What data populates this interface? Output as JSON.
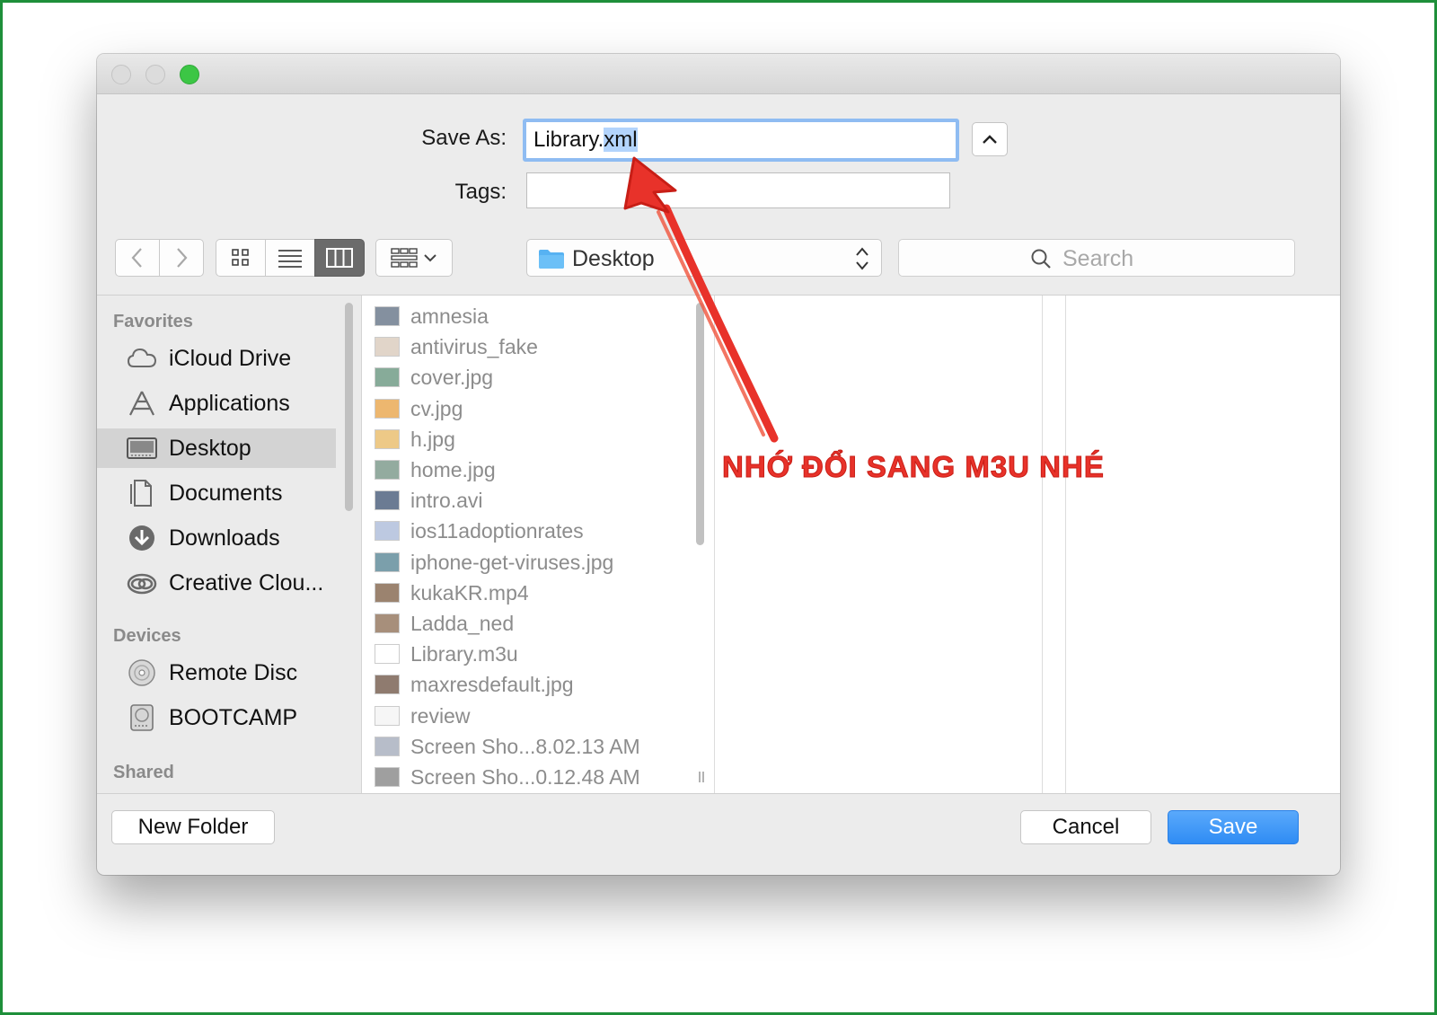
{
  "dialog": {
    "save_as_label": "Save As:",
    "filename_base": "Library.",
    "filename_selected": "xml",
    "tags_label": "Tags:",
    "tags_value": ""
  },
  "toolbar": {
    "location": "Desktop",
    "search_placeholder": "Search"
  },
  "sidebar": {
    "sections": [
      {
        "title": "Favorites",
        "items": [
          {
            "label": "iCloud Drive",
            "icon": "cloud-icon"
          },
          {
            "label": "Applications",
            "icon": "applications-icon"
          },
          {
            "label": "Desktop",
            "icon": "desktop-icon",
            "selected": true
          },
          {
            "label": "Documents",
            "icon": "documents-icon"
          },
          {
            "label": "Downloads",
            "icon": "downloads-icon"
          },
          {
            "label": "Creative Clou...",
            "icon": "creative-cloud-icon"
          }
        ]
      },
      {
        "title": "Devices",
        "items": [
          {
            "label": "Remote Disc",
            "icon": "disc-icon"
          },
          {
            "label": "BOOTCAMP",
            "icon": "drive-icon"
          }
        ]
      },
      {
        "title": "Shared",
        "items": []
      }
    ]
  },
  "files": [
    {
      "name": "amnesia"
    },
    {
      "name": "antivirus_fake"
    },
    {
      "name": "cover.jpg"
    },
    {
      "name": "cv.jpg"
    },
    {
      "name": "h.jpg"
    },
    {
      "name": "home.jpg"
    },
    {
      "name": "intro.avi"
    },
    {
      "name": "ios11adoptionrates"
    },
    {
      "name": "iphone-get-viruses.jpg"
    },
    {
      "name": "kukaKR.mp4"
    },
    {
      "name": "Ladda_ned"
    },
    {
      "name": "Library.m3u"
    },
    {
      "name": "maxresdefault.jpg"
    },
    {
      "name": "review"
    },
    {
      "name": "Screen Sho...8.02.13 AM"
    },
    {
      "name": "Screen Sho...0.12.48 AM"
    }
  ],
  "annotation": {
    "text": "NHỚ ĐỔI SANG M3U NHÉ",
    "color": "#e8322a"
  },
  "footer": {
    "new_folder_label": "New Folder",
    "cancel_label": "Cancel",
    "save_label": "Save"
  },
  "colors": {
    "accent": "#2f8cf4",
    "frame": "#1e8f3a",
    "zoom_light": "#3cc645"
  }
}
